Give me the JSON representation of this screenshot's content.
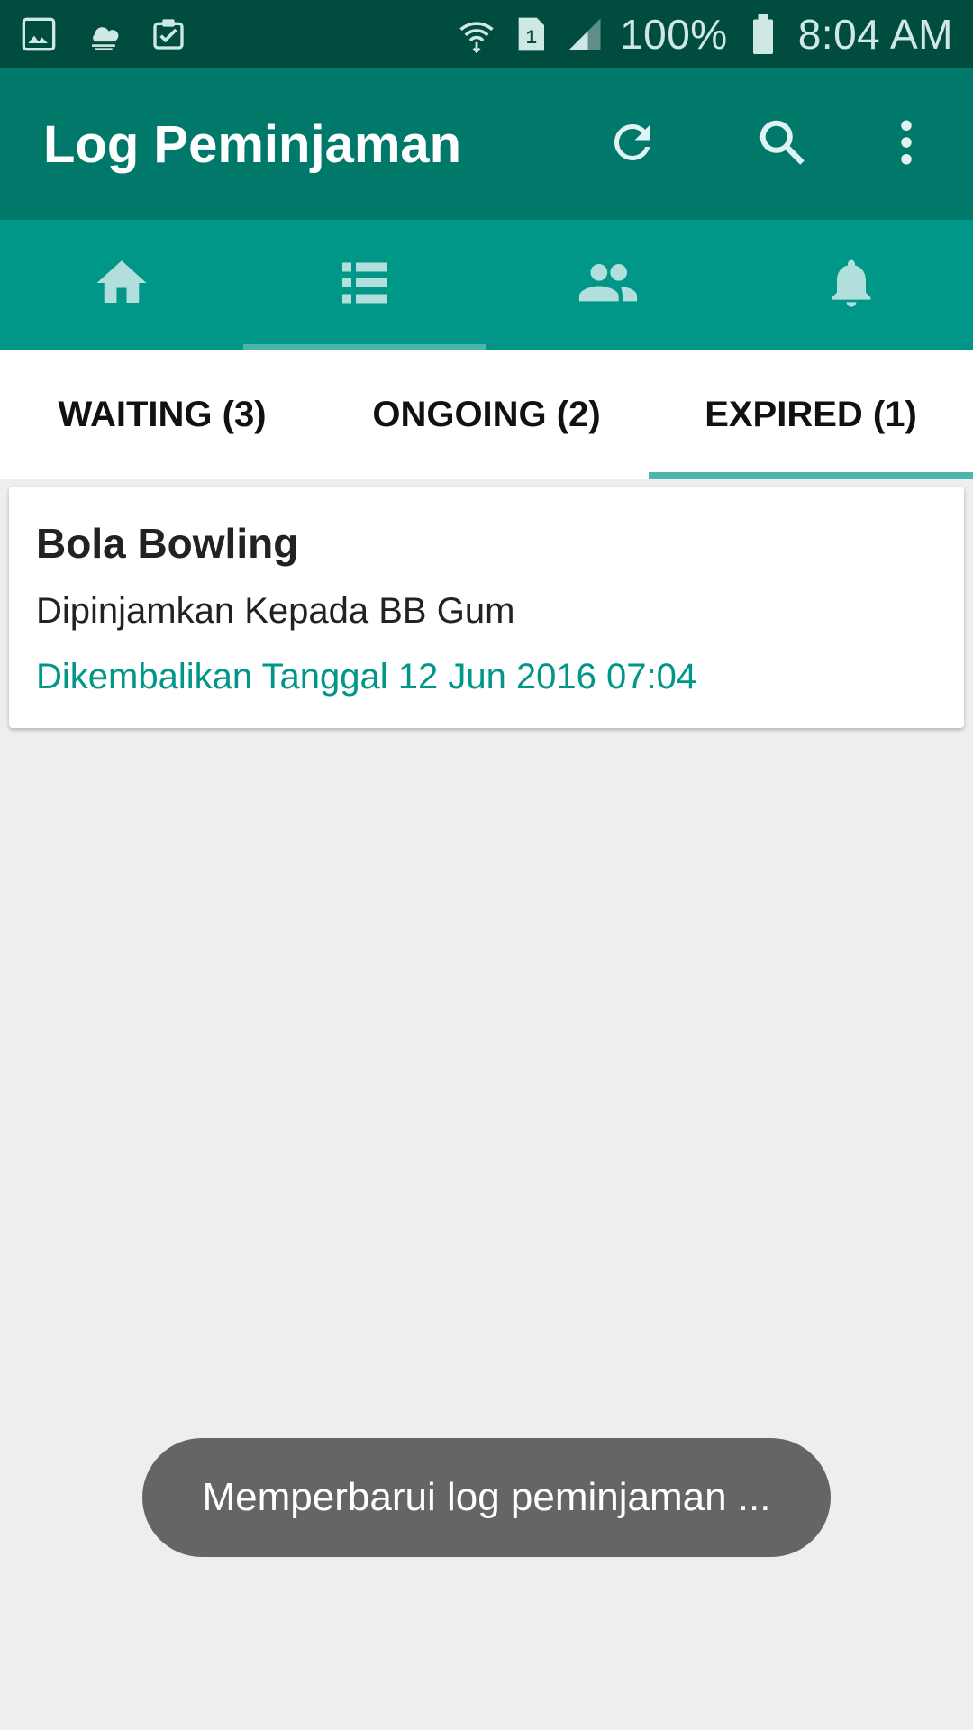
{
  "status_bar": {
    "icons_left": [
      "gallery-icon",
      "cloud-icon",
      "clipboard-check-icon"
    ],
    "icons_right": [
      "wifi-icon",
      "sim-icon",
      "signal-icon"
    ],
    "battery": "100%",
    "time": "8:04 AM"
  },
  "app_bar": {
    "title": "Log Peminjaman",
    "actions": [
      "refresh-icon",
      "search-icon",
      "more-vert-icon"
    ]
  },
  "nav": {
    "items": [
      "home-icon",
      "list-icon",
      "people-icon",
      "bell-icon"
    ],
    "active_index": 1
  },
  "tabs": [
    {
      "label": "WAITING (3)",
      "active": false
    },
    {
      "label": "ONGOING (2)",
      "active": false
    },
    {
      "label": "EXPIRED (1)",
      "active": true
    }
  ],
  "items": [
    {
      "title": "Bola Bowling",
      "subtitle": "Dipinjamkan Kepada BB Gum",
      "date": "Dikembalikan Tanggal 12 Jun 2016 07:04"
    }
  ],
  "toast": "Memperbarui log peminjaman ...",
  "colors": {
    "status_bar": "#004d40",
    "app_bar": "#00796b",
    "nav_bar": "#009688",
    "accent": "#4db6ac",
    "date_text": "#009688",
    "background": "#eeeeee"
  }
}
